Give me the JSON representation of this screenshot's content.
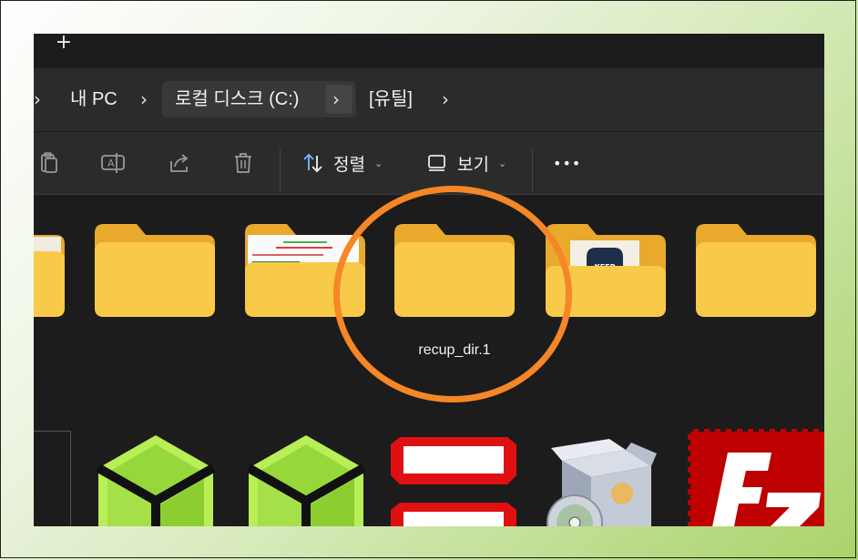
{
  "tabbar": {
    "new_tab_label": "+"
  },
  "breadcrumb": {
    "items": [
      "내 PC",
      "로컬 디스크 (C:)",
      "[유틸]"
    ]
  },
  "toolbar": {
    "icons": [
      "paste-icon",
      "rename-icon",
      "share-icon",
      "delete-icon"
    ],
    "sort_label": "정렬",
    "view_label": "보기",
    "more_label": "•••"
  },
  "folders": [
    {
      "name": "",
      "kind": "folder-partial"
    },
    {
      "name": "",
      "kind": "folder"
    },
    {
      "name": "",
      "kind": "folder-with-document"
    },
    {
      "name": "recup_dir.1",
      "kind": "folder"
    },
    {
      "name": "",
      "kind": "folder-with-keep-image"
    },
    {
      "name": "",
      "kind": "folder"
    }
  ],
  "files": [
    {
      "icon": "blank-thumbnail"
    },
    {
      "icon": "green-cube-icon"
    },
    {
      "icon": "green-cube-icon"
    },
    {
      "icon": "red-boxes-icon"
    },
    {
      "icon": "software-install-icon"
    },
    {
      "icon": "filezilla-icon"
    }
  ],
  "colors": {
    "highlight": "#f58726",
    "folder": "#f9c94a",
    "window_bg": "#1c1c1c",
    "bar_bg": "#2b2b2b"
  },
  "keep_image_text": "KEEP"
}
